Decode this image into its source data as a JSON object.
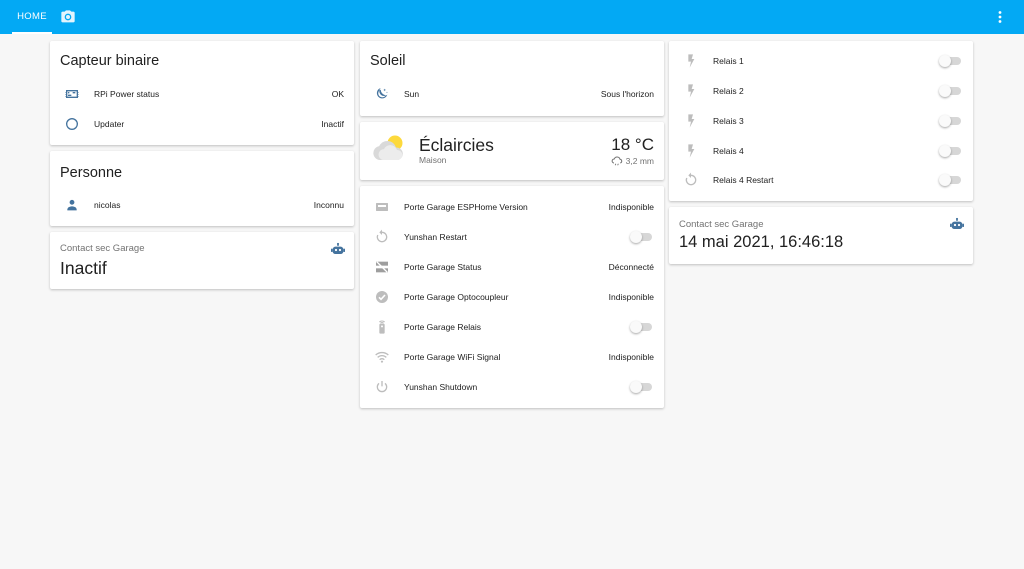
{
  "header": {
    "tabs": [
      {
        "label": "HOME",
        "active": true
      },
      {
        "icon": "camera-icon"
      }
    ],
    "menu_icon": "dots-vertical-icon",
    "color": "#03a9f4"
  },
  "capteur": {
    "title": "Capteur binaire",
    "rows": [
      {
        "icon": "chip-icon",
        "label": "RPi Power status",
        "value": "OK"
      },
      {
        "icon": "circle-outline-icon",
        "label": "Updater",
        "value": "Inactif"
      }
    ]
  },
  "personne": {
    "title": "Personne",
    "rows": [
      {
        "icon": "account-icon",
        "label": "nicolas",
        "value": "Inconnu"
      }
    ]
  },
  "contact_left": {
    "name": "Contact sec Garage",
    "state": "Inactif",
    "icon": "robot-icon"
  },
  "soleil": {
    "title": "Soleil",
    "rows": [
      {
        "icon": "moon-icon",
        "label": "Sun",
        "value": "Sous l'horizon"
      }
    ]
  },
  "weather": {
    "condition": "Éclaircies",
    "name": "Maison",
    "temperature": "18 °C",
    "precipitation": "3,2 mm",
    "icon": "partly-cloudy-icon"
  },
  "esphome": {
    "rows": [
      {
        "icon": "sd-card-icon",
        "label": "Porte Garage ESPHome Version",
        "value": "Indisponible"
      },
      {
        "icon": "restart-icon",
        "label": "Yunshan Restart",
        "toggle": false
      },
      {
        "icon": "lan-disconnect-icon",
        "label": "Porte Garage Status",
        "value": "Déconnecté"
      },
      {
        "icon": "check-circle-icon",
        "label": "Porte Garage Optocoupleur",
        "value": "Indisponible"
      },
      {
        "icon": "remote-icon",
        "label": "Porte Garage Relais",
        "toggle": false
      },
      {
        "icon": "wifi-icon",
        "label": "Porte Garage WiFi Signal",
        "value": "Indisponible"
      },
      {
        "icon": "power-icon",
        "label": "Yunshan Shutdown",
        "toggle": false
      }
    ]
  },
  "relais": {
    "rows": [
      {
        "icon": "flash-icon",
        "label": "Relais 1",
        "toggle": false
      },
      {
        "icon": "flash-icon",
        "label": "Relais 2",
        "toggle": false
      },
      {
        "icon": "flash-icon",
        "label": "Relais 3",
        "toggle": false
      },
      {
        "icon": "flash-icon",
        "label": "Relais 4",
        "toggle": false
      },
      {
        "icon": "restart-icon",
        "label": "Relais 4 Restart",
        "toggle": false
      }
    ]
  },
  "contact_right": {
    "name": "Contact sec Garage",
    "state": "14 mai 2021, 16:46:18",
    "icon": "robot-icon"
  }
}
